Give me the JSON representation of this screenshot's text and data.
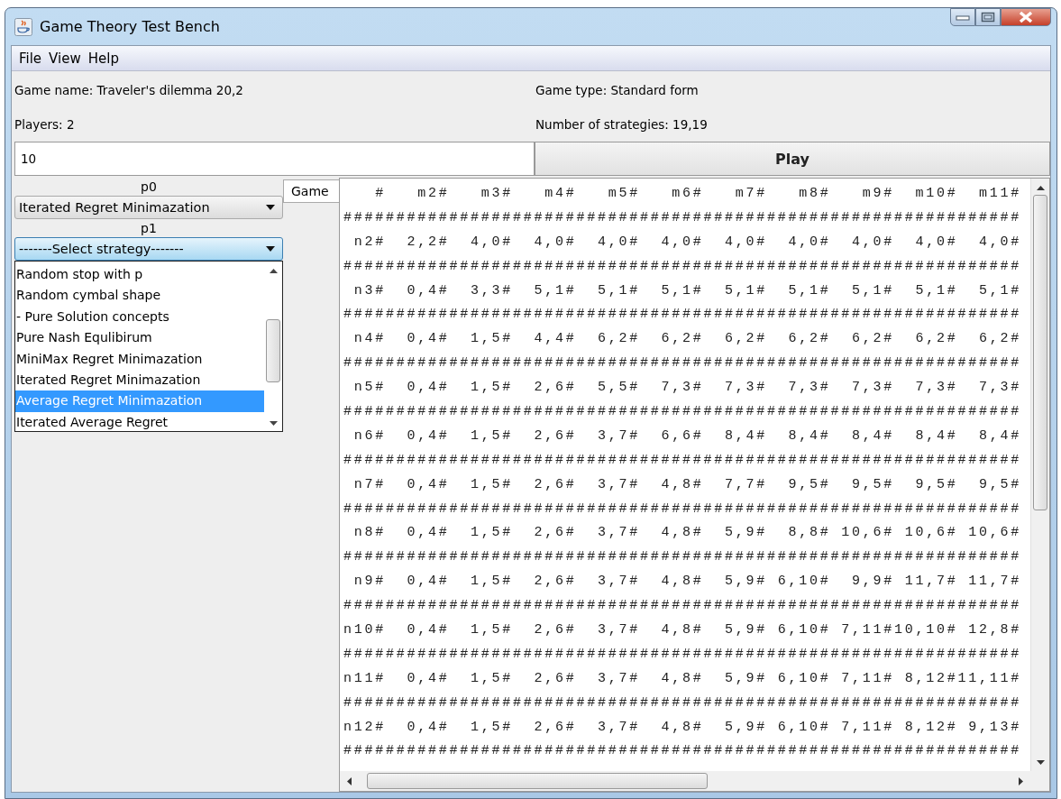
{
  "window": {
    "title": "Game Theory Test Bench"
  },
  "menu": [
    "File",
    "View",
    "Help"
  ],
  "info": {
    "game_name": "Game name: Traveler's dilemma 20,2",
    "game_type": "Game type: Standard form",
    "players": "Players: 2",
    "strategies": "Number of strategies: 19,19"
  },
  "rounds_field": {
    "value": "10"
  },
  "play_button": "Play",
  "players": [
    {
      "label": "p0",
      "strategy": "Iterated Regret Minimazation",
      "open": false
    },
    {
      "label": "p1",
      "strategy": "-------Select strategy-------",
      "open": true
    }
  ],
  "strategy_list": [
    {
      "label": "Random stop with p",
      "selected": false
    },
    {
      "label": "Random cymbal shape",
      "selected": false
    },
    {
      "label": "- Pure Solution concepts",
      "selected": false
    },
    {
      "label": "Pure Nash Equlibirum",
      "selected": false
    },
    {
      "label": "MiniMax Regret Minimazation",
      "selected": false
    },
    {
      "label": "Iterated Regret Minimazation",
      "selected": false
    },
    {
      "label": "Average Regret Minimazation",
      "selected": true
    },
    {
      "label": "Iterated Average Regret",
      "selected": false
    }
  ],
  "tabs": [
    {
      "label": "Game",
      "selected": true
    }
  ],
  "game_text": [
    "   #   m2#   m3#   m4#   m5#   m6#   m7#   m8#   m9#  m10#  m11#",
    "################################################################",
    " n2#  2,2#  4,0#  4,0#  4,0#  4,0#  4,0#  4,0#  4,0#  4,0#  4,0#",
    "################################################################",
    " n3#  0,4#  3,3#  5,1#  5,1#  5,1#  5,1#  5,1#  5,1#  5,1#  5,1#",
    "################################################################",
    " n4#  0,4#  1,5#  4,4#  6,2#  6,2#  6,2#  6,2#  6,2#  6,2#  6,2#",
    "################################################################",
    " n5#  0,4#  1,5#  2,6#  5,5#  7,3#  7,3#  7,3#  7,3#  7,3#  7,3#",
    "################################################################",
    " n6#  0,4#  1,5#  2,6#  3,7#  6,6#  8,4#  8,4#  8,4#  8,4#  8,4#",
    "################################################################",
    " n7#  0,4#  1,5#  2,6#  3,7#  4,8#  7,7#  9,5#  9,5#  9,5#  9,5#",
    "################################################################",
    " n8#  0,4#  1,5#  2,6#  3,7#  4,8#  5,9#  8,8# 10,6# 10,6# 10,6#",
    "################################################################",
    " n9#  0,4#  1,5#  2,6#  3,7#  4,8#  5,9# 6,10#  9,9# 11,7# 11,7#",
    "################################################################",
    "n10#  0,4#  1,5#  2,6#  3,7#  4,8#  5,9# 6,10# 7,11#10,10# 12,8#",
    "################################################################",
    "n11#  0,4#  1,5#  2,6#  3,7#  4,8#  5,9# 6,10# 7,11# 8,12#11,11#",
    "################################################################",
    "n12#  0,4#  1,5#  2,6#  3,7#  4,8#  5,9# 6,10# 7,11# 8,12# 9,13#",
    "################################################################"
  ]
}
